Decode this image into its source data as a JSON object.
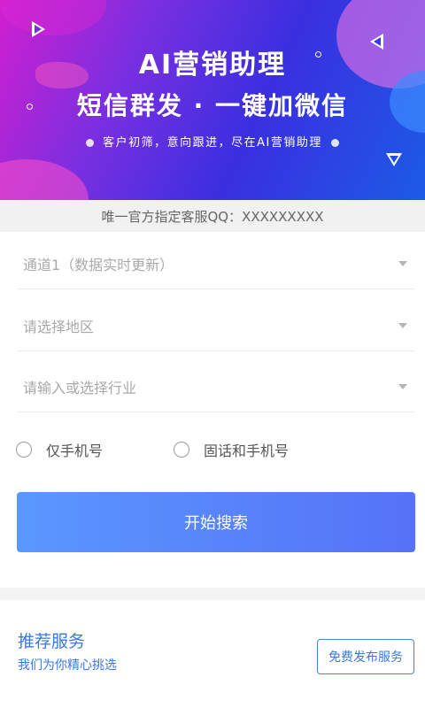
{
  "banner": {
    "title": "AI营销助理",
    "headline": "短信群发 · 一键加微信",
    "tagline": "客户初筛，意向跟进，尽在AI营销助理",
    "colors": {
      "gradient_start": "#d11fd0",
      "gradient_mid": "#3a2fe0",
      "gradient_end": "#1c5be6"
    }
  },
  "service_bar": {
    "text": "唯一官方指定客服QQ：XXXXXXXXX"
  },
  "form": {
    "channel_placeholder": "通道1（数据实时更新）",
    "region_placeholder": "请选择地区",
    "industry_placeholder": "请输入或选择行业",
    "radio_options": [
      "仅手机号",
      "固话和手机号"
    ],
    "search_label": "开始搜索"
  },
  "recommend": {
    "title": "推荐服务",
    "subtitle": "我们为你精心挑选",
    "publish_label": "免费发布服务"
  },
  "accent_color": "#3b78e0",
  "icons": [
    "chevron-down-icon",
    "radio-circle-icon",
    "triangle-decoration-icon",
    "ring-decoration-icon"
  ]
}
